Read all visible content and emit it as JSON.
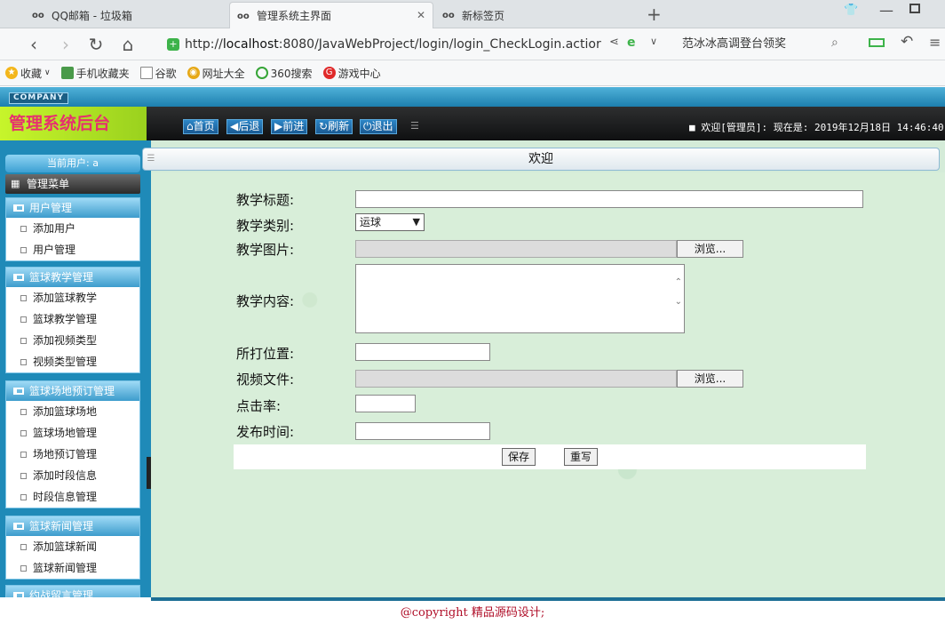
{
  "browser": {
    "tabs": [
      {
        "title": "QQ邮箱 - 垃圾箱"
      },
      {
        "title": "管理系统主界面"
      },
      {
        "title": "新标签页"
      }
    ],
    "new_tab": "+",
    "url_prefix": "http://",
    "url_host": "localhost",
    "url_rest": ":8080/JavaWebProject/login/login_CheckLogin.actior",
    "search_text": "范冰冰高调登台领奖",
    "bookmarks": [
      "收藏",
      "手机收藏夹",
      "谷歌",
      "网址大全",
      "360搜索",
      "游戏中心"
    ]
  },
  "app": {
    "company_badge": "COMPANY",
    "logo": "管理系统后台",
    "toolbar": [
      "首页",
      "后退",
      "前进",
      "刷新",
      "退出"
    ],
    "welcome": "欢迎[管理员]: 现在是: 2019年12月18日 14:46:40",
    "current_user": "当前用户: a",
    "main_menu": "管理菜单",
    "menu_groups": [
      {
        "title": "用户管理",
        "items": [
          "添加用户",
          "用户管理"
        ]
      },
      {
        "title": "篮球教学管理",
        "items": [
          "添加篮球教学",
          "篮球教学管理",
          "添加视频类型",
          "视频类型管理"
        ]
      },
      {
        "title": "篮球场地预订管理",
        "items": [
          "添加篮球场地",
          "篮球场地管理",
          "场地预订管理",
          "添加时段信息",
          "时段信息管理"
        ]
      },
      {
        "title": "篮球新闻管理",
        "items": [
          "添加篮球新闻",
          "篮球新闻管理"
        ]
      },
      {
        "title": "约战留言管理",
        "items": []
      }
    ],
    "tab_title": "欢迎",
    "form": {
      "title_label": "教学标题:",
      "category_label": "教学类别:",
      "category_value": "运球",
      "image_label": "教学图片:",
      "browse": "浏览...",
      "content_label": "教学内容:",
      "position_label": "所打位置:",
      "video_label": "视频文件:",
      "clicks_label": "点击率:",
      "date_label": "发布时间:",
      "save": "保存",
      "reset": "重写"
    },
    "copyright": "@copyright 精品源码设计;"
  }
}
